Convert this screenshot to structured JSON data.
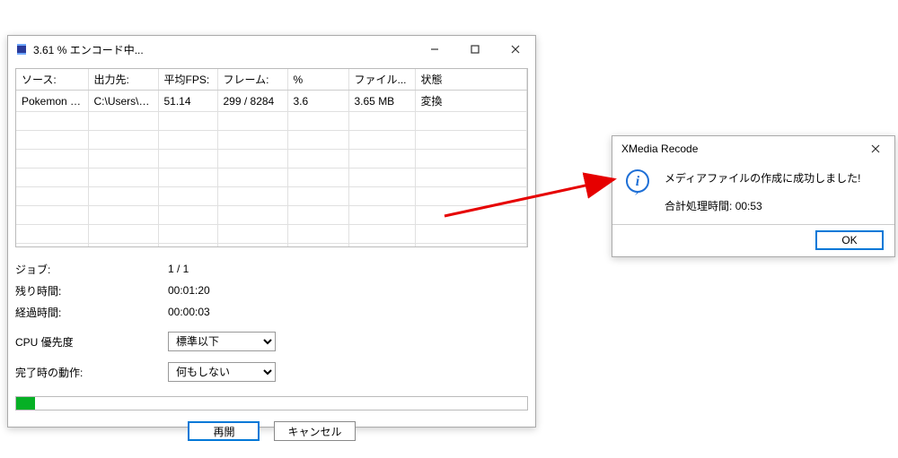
{
  "main": {
    "title": "3.61 % エンコード中...",
    "columns": {
      "source": "ソース:",
      "dest": "出力先:",
      "avg_fps": "平均FPS:",
      "frame": "フレーム:",
      "percent": "%",
      "file": "ファイル...",
      "status": "状態"
    },
    "row": {
      "source": "Pokemon Jo...",
      "dest": "C:\\Users\\A...",
      "avg_fps": "51.14",
      "frame": "299 / 8284",
      "percent": "3.6",
      "file": "3.65 MB",
      "status": "変換"
    },
    "info": {
      "job_label": "ジョブ:",
      "job_value": "1 / 1",
      "remaining_label": "残り時間:",
      "remaining_value": "00:01:20",
      "elapsed_label": "経過時間:",
      "elapsed_value": "00:00:03"
    },
    "cpu": {
      "label": "CPU 優先度",
      "value": "標準以下"
    },
    "on_complete": {
      "label": "完了時の動作:",
      "value": "何もしない"
    },
    "progress_percent": 3.61,
    "buttons": {
      "resume": "再開",
      "cancel": "キャンセル"
    }
  },
  "dialog": {
    "title": "XMedia Recode",
    "message": "メディアファイルの作成に成功しました!",
    "time_label": "合計処理時間:",
    "time_value": "00:53",
    "ok": "OK"
  }
}
